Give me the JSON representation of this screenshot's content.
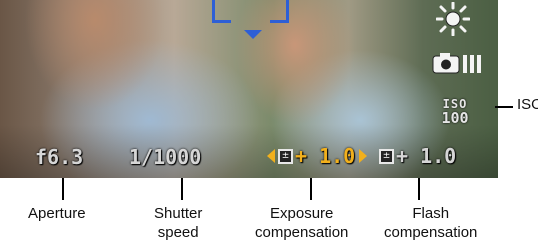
{
  "viewfinder": {
    "aperture": "f6.3",
    "shutter_speed": "1/1000",
    "exposure_compensation": "+ 1.0",
    "flash_compensation": "+ 1.0",
    "iso_top": "ISO",
    "iso_bottom": "100",
    "icons": [
      "focus-bracket-icon",
      "sun-icon",
      "camera-mode-icon",
      "iso-icon",
      "exposure-comp-icon",
      "flash-comp-icon"
    ],
    "colors": {
      "highlight": "#f2b01c",
      "focus": "#2e5fd6",
      "overlay_text": "#d6d6d6"
    }
  },
  "callouts": {
    "aperture": "Aperture",
    "shutter_line1": "Shutter",
    "shutter_line2": "speed",
    "exposure_line1": "Exposure",
    "exposure_line2": "compensation",
    "flash_line1": "Flash",
    "flash_line2": "compensation",
    "iso": "ISO"
  }
}
